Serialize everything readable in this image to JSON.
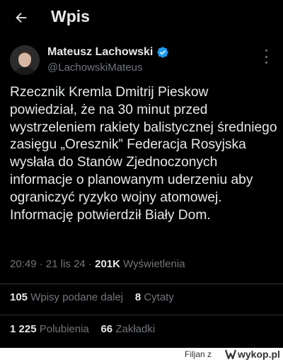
{
  "header": {
    "title": "Wpis",
    "back_icon": "arrow-left-icon"
  },
  "author": {
    "name": "Mateusz Lachowski",
    "handle": "@LachowskiMateus",
    "verified": true,
    "verified_color": "#1d9bf0"
  },
  "post": {
    "text": "Rzecznik Kremla Dmitrij Pieskow powiedział, że na 30 minut przed wystrzeleniem rakiety balistycznej średniego zasięgu „Oresznik” Federacja Rosyjska wysłała do Stanów Zjednoczonych informacje o planowanym uderzeniu aby ograniczyć ryzyko wojny atomowej. Informację potwierdził Biały Dom.",
    "time": "20:49",
    "date": "21 lis 24",
    "separator": "·",
    "views_count": "201K",
    "views_label": "Wyświetlenia"
  },
  "stats": {
    "reposts_count": "105",
    "reposts_label": "Wpisy podane dalej",
    "quotes_count": "8",
    "quotes_label": "Cytaty",
    "likes_count": "1 225",
    "likes_label": "Polubienia",
    "bookmarks_count": "66",
    "bookmarks_label": "Zakładki"
  },
  "footer": {
    "user": "Filjan",
    "site_prefix": "z",
    "logo_text": "wykop.pl"
  },
  "colors": {
    "background": "#000000",
    "text": "#e7e9ea",
    "muted": "#71767b",
    "divider": "#2f3336"
  }
}
